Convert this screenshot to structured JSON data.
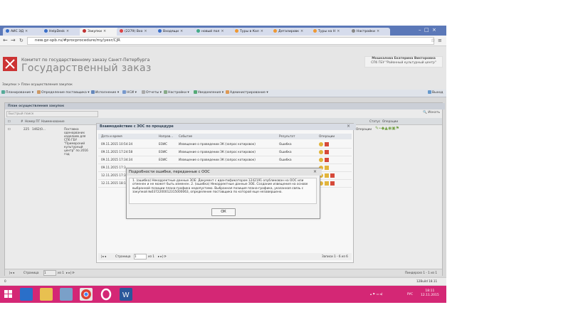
{
  "browser": {
    "tabs": [
      {
        "label": "АИС ЭД"
      },
      {
        "label": "HelpDesk"
      },
      {
        "label": "Закупки"
      },
      {
        "label": "(2279) Вхо"
      },
      {
        "label": "Входящи"
      },
      {
        "label": "новый пол"
      },
      {
        "label": "Туры в Кол"
      },
      {
        "label": "Деталировк"
      },
      {
        "label": "Туры на Н"
      },
      {
        "label": "Настройки"
      }
    ],
    "url": "new.gz-spb.ru/#procprocedure/my/yesr/CJR"
  },
  "site": {
    "org_small": "Комитет по государственному заказу Санкт-Петербурга",
    "org_big": "Государственный заказ",
    "user_name": "Мошкалова Екатерина Викторовна",
    "user_org": "СПб ГБУ \"Районный культурный центр\""
  },
  "breadcrumb": "Закупки > План осуществления закупок",
  "menu": [
    {
      "label": "Планирование"
    },
    {
      "label": "Определение поставщика"
    },
    {
      "label": "Исполнение"
    },
    {
      "label": "НСИ"
    },
    {
      "label": "Отчеты"
    },
    {
      "label": "Настройки"
    },
    {
      "label": "Уведомления"
    },
    {
      "label": "Администрирование"
    }
  ],
  "menu_exit": "Выход",
  "main": {
    "title": "План осуществления закупок",
    "search_placeholder": "Быстрый поиск",
    "find_label": "Искать",
    "headers": [
      "#",
      "Номер ПГ",
      "Наименование",
      "Статус",
      "Операции"
    ],
    "row": {
      "num": "225",
      "pg": "1462(0...",
      "name": "Поставка оденорваних изделиев для СПб ГБУ \"Приморский культурный центр\" по 2016 год",
      "status": "Операции"
    },
    "pager_label": "Страница",
    "pager_value": "1",
    "pager_of": "из 1",
    "footer_right": "Пиндерсиз 1 - 1 из 1"
  },
  "interaction": {
    "title": "Взаимодействие с ЭОС по процедуре",
    "headers": [
      "Дата и время",
      "Направ...",
      "Событие",
      "Результат",
      "Операции"
    ],
    "rows": [
      {
        "date": "09.11.2015 10:54:34",
        "dir": "ЕОИС",
        "event": "Извещение о проведении ЗК (запрос котировок)",
        "result": "Ошибка"
      },
      {
        "date": "09.11.2015 17:24:58",
        "dir": "ЕОИС",
        "event": "Извещение о проведении ЗК (запрос котировок)",
        "result": "Ошибка"
      },
      {
        "date": "09.11.2015 17:34:34",
        "dir": "ЕОИС",
        "event": "Извещение о проведении ЗК (запрос котировок)",
        "result": "Ошибка"
      },
      {
        "date": "09.11.2015 17:3",
        "dir": "",
        "event": "",
        "result": ""
      },
      {
        "date": "12.11.2015 17:3",
        "dir": "",
        "event": "",
        "result": ""
      },
      {
        "date": "12.11.2015 18:1",
        "dir": "",
        "event": "",
        "result": ""
      }
    ],
    "pager_label": "Страница",
    "pager_value": "1",
    "pager_of": "из 1",
    "footer_right": "Записи 1 - 6 из 6"
  },
  "error_dialog": {
    "title": "Подробности ошибки, переданные с ООС",
    "message": "1. (ошибка) Некорректные данные ЗОЕ: Документ с идентификатором 1242191 опубликован на ООС или отменен и не может быть изменен. 2. (ошибка) Некорректные данные ЗОЕ. Создание извещения на основе выбранной позиции плана-графика недопустимо. Выбранная позиция плана-графика, указанная связь с закупкой №0372200012315000063, определение поставщика по которой еще незавершено.",
    "ok_label": "ОК"
  },
  "statusbar": {
    "left": "0",
    "right": "12Build 18.11"
  },
  "taskbar": {
    "lang": "РУС",
    "time": "18:11",
    "date": "12.11.2015"
  },
  "colors": {
    "tabbar": "#5b78b8",
    "taskbar": "#d42775",
    "logo": "#cc3333",
    "warning": "#e2b43b",
    "error": "#d64a3a"
  }
}
